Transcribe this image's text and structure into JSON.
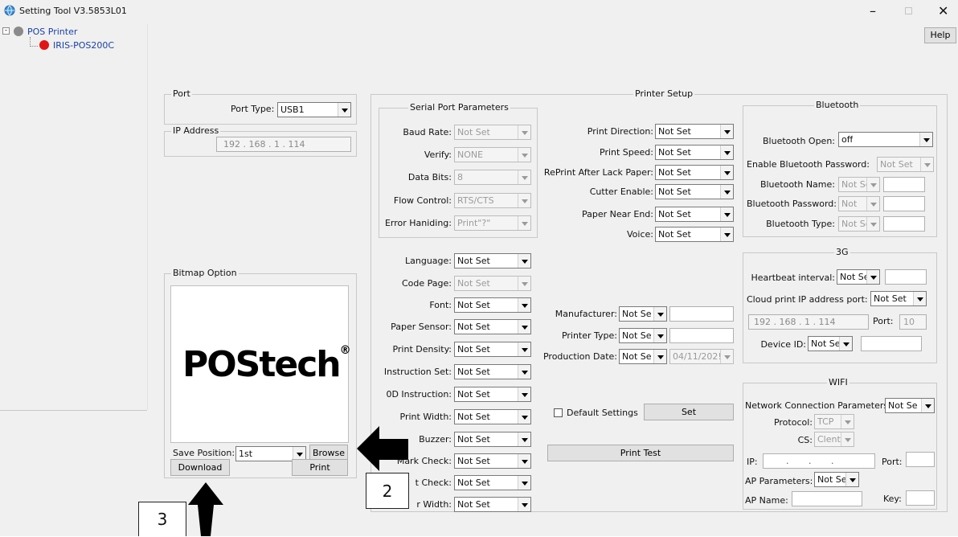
{
  "window": {
    "title": "Setting Tool V3.5853L01",
    "help_label": "Help"
  },
  "tree": {
    "root": "POS Printer",
    "child": "IRIS-POS200C"
  },
  "port": {
    "legend": "Port",
    "type_label": "Port Type:",
    "type_value": "USB1"
  },
  "ip": {
    "legend": "IP Address",
    "value": "192 . 168 . 1 . 114"
  },
  "bitmap": {
    "legend": "Bitmap Option",
    "logo": "POStech",
    "save_label": "Save Position:",
    "save_value": "1st",
    "browse": "Browse",
    "download": "Download",
    "print": "Print"
  },
  "printer_setup": {
    "legend": "Printer Setup"
  },
  "serial": {
    "legend": "Serial Port Parameters",
    "rows": [
      {
        "label": "Baud Rate:",
        "value": "Not Set"
      },
      {
        "label": "Verify:",
        "value": "NONE"
      },
      {
        "label": "Data Bits:",
        "value": "8"
      },
      {
        "label": "Flow Control:",
        "value": "RTS/CTS"
      },
      {
        "label": "Error Haniding:",
        "value": "Print\"?\""
      }
    ]
  },
  "mid": {
    "rows": [
      {
        "label": "Print Direction:",
        "value": "Not Set"
      },
      {
        "label": "Print Speed:",
        "value": "Not Set"
      },
      {
        "label": "RePrint After Lack Paper:",
        "value": "Not Set"
      },
      {
        "label": "Cutter Enable:",
        "value": "Not Set"
      },
      {
        "label": "Paper Near End:",
        "value": "Not Set"
      },
      {
        "label": "Voice:",
        "value": "Not Set"
      }
    ]
  },
  "lower": {
    "rows": [
      {
        "label": "Language:",
        "value": "Not Set"
      },
      {
        "label": "Code Page:",
        "value": "Not Set"
      },
      {
        "label": "Font:",
        "value": "Not Set"
      },
      {
        "label": "Paper Sensor:",
        "value": "Not Set"
      },
      {
        "label": "Print Density:",
        "value": "Not Set"
      },
      {
        "label": "Instruction Set:",
        "value": "Not Set"
      },
      {
        "label": "0D Instruction:",
        "value": "Not Set"
      },
      {
        "label": "Print Width:",
        "value": "Not Set"
      },
      {
        "label": "Buzzer:",
        "value": "Not Set"
      },
      {
        "label": "Mark Check:",
        "value": "Not Set"
      },
      {
        "label": "t Check:",
        "value": "Not Set"
      },
      {
        "label": "r Width:",
        "value": "Not Set"
      }
    ]
  },
  "info": {
    "manufacturer_label": "Manufacturer:",
    "manufacturer_value": "Not Se",
    "type_label": "Printer Type:",
    "type_value": "Not Se",
    "date_label": "Production Date:",
    "date_value": "Not Se",
    "date_text": "04/11/202!"
  },
  "default": {
    "label": "Default Settings",
    "set": "Set",
    "print_test": "Print Test"
  },
  "bluetooth": {
    "legend": "Bluetooth",
    "open_label": "Bluetooth Open:",
    "open_value": "off",
    "pwd_enable_label": "Enable Bluetooth Password:",
    "pwd_enable_value": "Not Set",
    "name_label": "Bluetooth Name:",
    "name_value": "Not Se",
    "pwd_label": "Bluetooth Password:",
    "pwd_value": "Not",
    "type_label": "Bluetooth Type:",
    "type_value": "Not Se"
  },
  "g3": {
    "legend": "3G",
    "hb_label": "Heartbeat interval:",
    "hb_value": "Not Se",
    "cloud_label": "Cloud print IP address port:",
    "cloud_value": "Not Set",
    "ip_value": "192 . 168 . 1 . 114",
    "port_label": "Port:",
    "port_value": "10",
    "device_label": "Device ID:",
    "device_value": "Not Se"
  },
  "wifi": {
    "legend": "WIFI",
    "net_label": "Network Connection Parameters:",
    "net_value": "Not Se",
    "protocol_label": "Protocol:",
    "protocol_value": "TCP",
    "cs_label": "CS:",
    "cs_value": "Clent",
    "ip_label": "IP:",
    "ip_value": ".       .       .",
    "port_label": "Port:",
    "ap_label": "AP Parameters:",
    "ap_value": "Not Se",
    "apname_label": "AP Name:",
    "key_label": "Key:"
  },
  "annotations": {
    "a2": "2",
    "a3": "3"
  }
}
